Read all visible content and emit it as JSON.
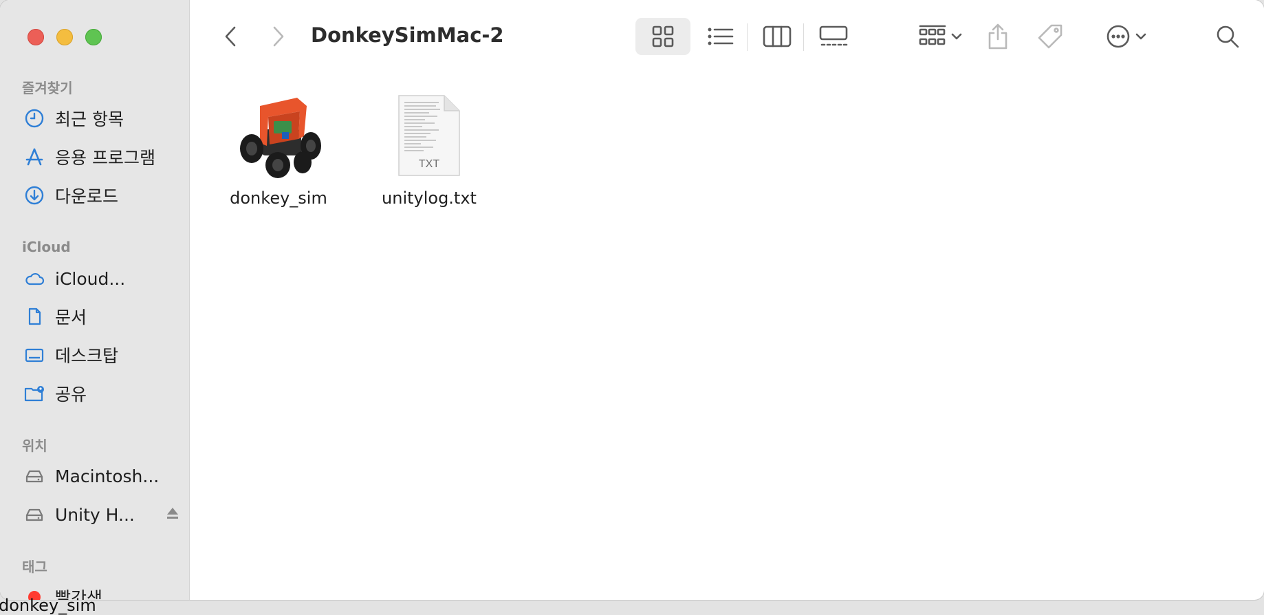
{
  "window": {
    "title": "DonkeySimMac-2"
  },
  "sidebar": {
    "sections": [
      {
        "header": "즐겨찾기",
        "items": [
          {
            "label": "최근 항목",
            "icon": "clock-icon"
          },
          {
            "label": "응용 프로그램",
            "icon": "applications-icon"
          },
          {
            "label": "다운로드",
            "icon": "download-icon"
          }
        ]
      },
      {
        "header": "iCloud",
        "items": [
          {
            "label": "iCloud...",
            "icon": "cloud-icon"
          },
          {
            "label": "문서",
            "icon": "document-icon"
          },
          {
            "label": "데스크탑",
            "icon": "desktop-icon"
          },
          {
            "label": "공유",
            "icon": "shared-folder-icon"
          }
        ]
      },
      {
        "header": "위치",
        "items": [
          {
            "label": "Macintosh...",
            "icon": "drive-icon"
          },
          {
            "label": "Unity H...",
            "icon": "drive-icon"
          }
        ]
      },
      {
        "header": "태그",
        "items": [
          {
            "label": "빨간색",
            "icon": "red-tag-dot",
            "color": "#ff3b30"
          }
        ]
      }
    ]
  },
  "files": [
    {
      "name": "donkey_sim",
      "icon": "robot-car-app-icon"
    },
    {
      "name": "unitylog.txt",
      "icon": "text-file-icon",
      "badge": "TXT"
    }
  ],
  "overflow_text": "donkey_sim",
  "colors": {
    "sidebar_icon": "#2f7fd6",
    "close": "#ec5f57",
    "minimize": "#f4bd3f",
    "maximize": "#5fc452"
  }
}
